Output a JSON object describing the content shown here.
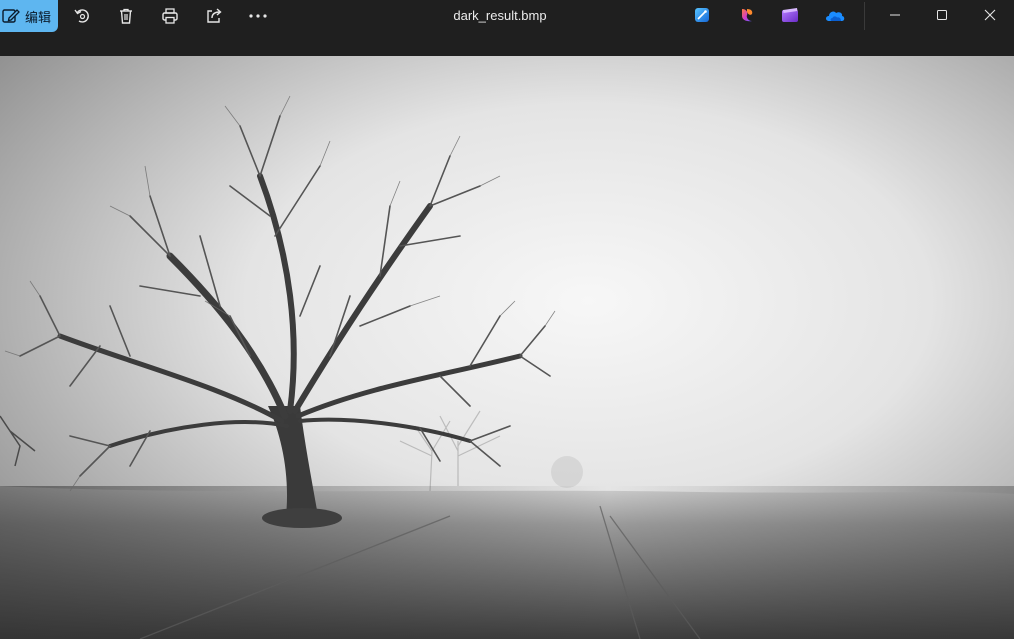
{
  "toolbar": {
    "edit_label": "编辑",
    "icons": [
      "rotate-icon",
      "delete-icon",
      "print-icon",
      "share-icon",
      "more-icon"
    ]
  },
  "window": {
    "title": "dark_result.bmp"
  },
  "app_icons": [
    "designer-icon",
    "copilot-icon",
    "clipchamp-icon",
    "onedrive-icon"
  ],
  "colors": {
    "accent": "#5eb6f0",
    "titlebar": "#1f1f1f"
  },
  "image": {
    "description_icon": "foggy-tree-photo"
  }
}
